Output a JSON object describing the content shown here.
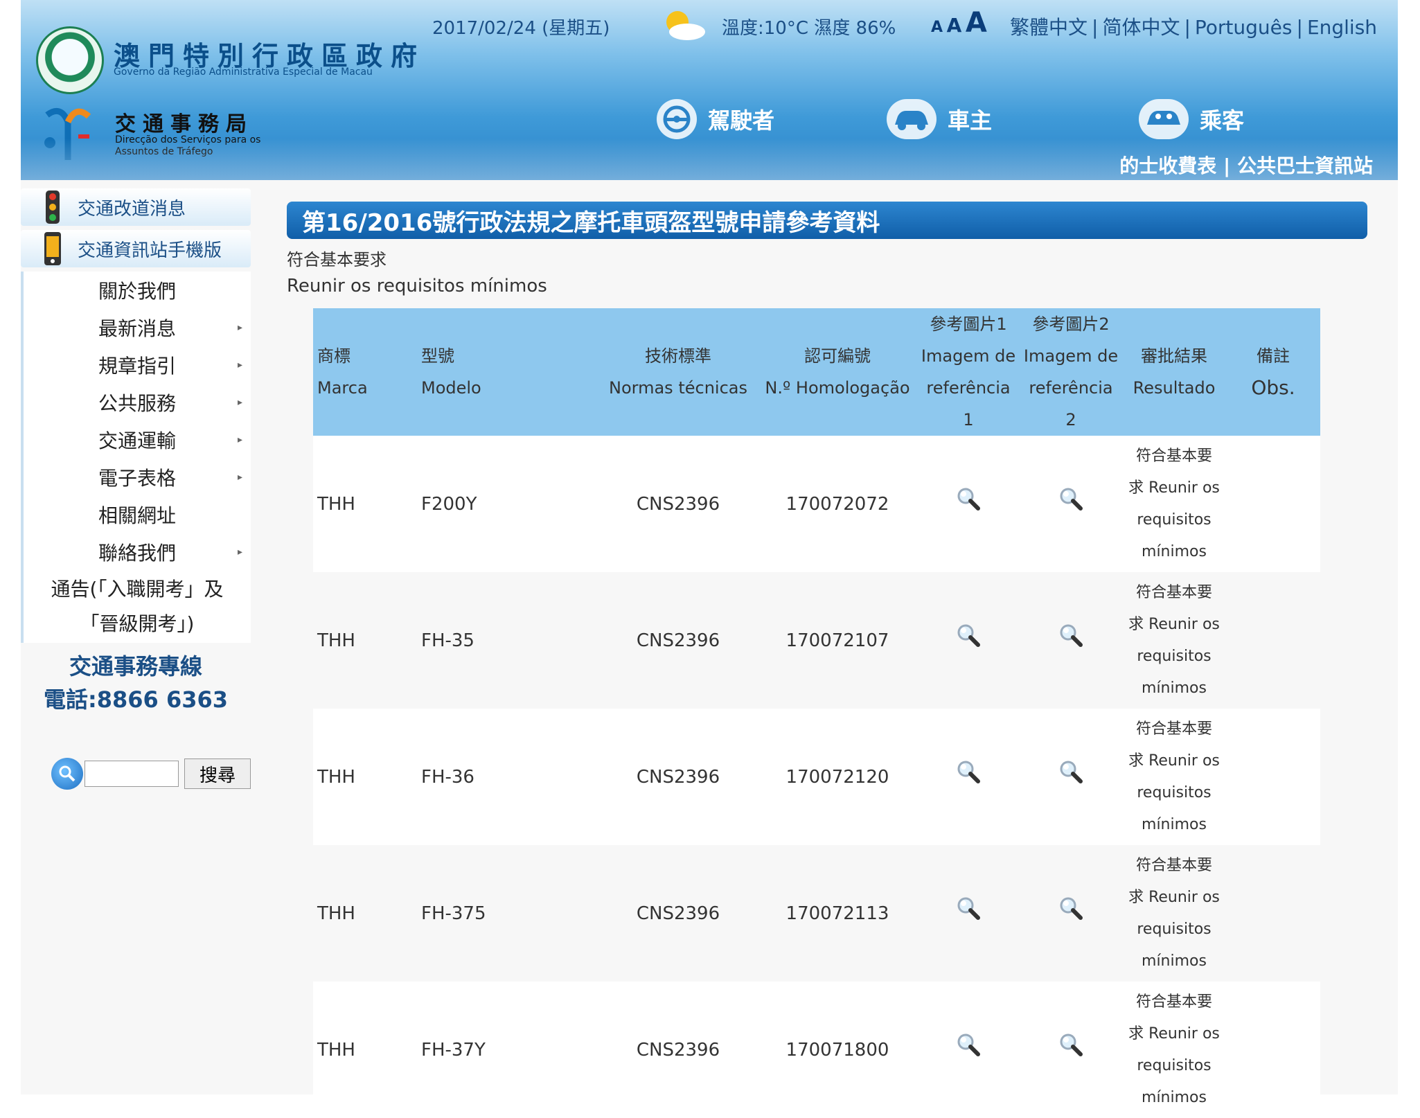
{
  "header": {
    "gov_name_zh": "澳門特別行政區政府",
    "gov_name_pt": "Governo da Região Administrativa Especial de Macau",
    "dsat_name_zh": "交通事務局",
    "dsat_name_pt": "Direcção dos Serviços para os Assuntos de Tráfego",
    "date": "2017/02/24 (星期五)",
    "weather": "溫度:10°C 濕度 86%",
    "font_size_labels": [
      "A",
      "A",
      "A"
    ],
    "languages": [
      "繁體中文",
      "简体中文",
      "Português",
      "English"
    ],
    "lang_separator": "|",
    "nav": [
      {
        "label": "駕駛者",
        "icon": "steering-wheel-icon"
      },
      {
        "label": "車主",
        "icon": "car-icon"
      },
      {
        "label": "乘客",
        "icon": "passenger-car-icon"
      }
    ],
    "quick_links": [
      "的士收費表",
      "公共巴士資訊站"
    ]
  },
  "sidebar": {
    "promos": [
      {
        "label": "交通改道消息",
        "icon": "traffic-light-icon"
      },
      {
        "label": "交通資訊站手機版",
        "icon": "mobile-phone-icon"
      }
    ],
    "menu": [
      {
        "label": "關於我們",
        "has_submenu": false
      },
      {
        "label": "最新消息",
        "has_submenu": true
      },
      {
        "label": "規章指引",
        "has_submenu": true
      },
      {
        "label": "公共服務",
        "has_submenu": true
      },
      {
        "label": "交通運輸",
        "has_submenu": true
      },
      {
        "label": "電子表格",
        "has_submenu": true
      },
      {
        "label": "相關網址",
        "has_submenu": false
      },
      {
        "label": "聯絡我們",
        "has_submenu": true
      }
    ],
    "notice_line1": "通告(「入職開考」及",
    "notice_line2": "「晉級開考」)",
    "hotline_label": "交通事務專線",
    "hotline_phone": "電話:8866 6363",
    "search_value": "",
    "search_button": "搜尋",
    "submenu_arrow": "▸"
  },
  "main": {
    "title": "第16/2016號行政法規之摩托車頭盔型號申請參考資料",
    "subtitle_zh": "符合基本要求",
    "subtitle_pt": "Reunir os requisitos mínimos",
    "columns": [
      {
        "zh": "商標",
        "pt": "Marca"
      },
      {
        "zh": "型號",
        "pt": "Modelo"
      },
      {
        "zh": "技術標準",
        "pt": "Normas técnicas"
      },
      {
        "zh": "認可編號",
        "pt": "N.º Homologação"
      },
      {
        "zh": "參考圖片1",
        "pt": "Imagem de referência 1"
      },
      {
        "zh": "參考圖片2",
        "pt": "Imagem de referência 2"
      },
      {
        "zh": "審批結果",
        "pt": "Resultado"
      },
      {
        "zh": "備註",
        "pt": "Obs."
      }
    ],
    "rows": [
      {
        "brand": "THH",
        "model": "F200Y",
        "standard": "CNS2396",
        "approval_no": "170072072",
        "result_line1": "符合基本要",
        "result_line2": "求 Reunir os",
        "result_line3": "requisitos",
        "result_line4": "mínimos",
        "obs": ""
      },
      {
        "brand": "THH",
        "model": "FH-35",
        "standard": "CNS2396",
        "approval_no": "170072107",
        "result_line1": "符合基本要",
        "result_line2": "求 Reunir os",
        "result_line3": "requisitos",
        "result_line4": "mínimos",
        "obs": ""
      },
      {
        "brand": "THH",
        "model": "FH-36",
        "standard": "CNS2396",
        "approval_no": "170072120",
        "result_line1": "符合基本要",
        "result_line2": "求 Reunir os",
        "result_line3": "requisitos",
        "result_line4": "mínimos",
        "obs": ""
      },
      {
        "brand": "THH",
        "model": "FH-375",
        "standard": "CNS2396",
        "approval_no": "170072113",
        "result_line1": "符合基本要",
        "result_line2": "求 Reunir os",
        "result_line3": "requisitos",
        "result_line4": "mínimos",
        "obs": ""
      },
      {
        "brand": "THH",
        "model": "FH-37Y",
        "standard": "CNS2396",
        "approval_no": "170071800",
        "result_line1": "符合基本要",
        "result_line2": "求 Reunir os",
        "result_line3": "requisitos",
        "result_line4": "mínimos",
        "obs": ""
      }
    ]
  },
  "colors": {
    "title_bar": "#1565b0",
    "table_header": "#8ec8ee",
    "link_blue": "#1b4f86"
  }
}
